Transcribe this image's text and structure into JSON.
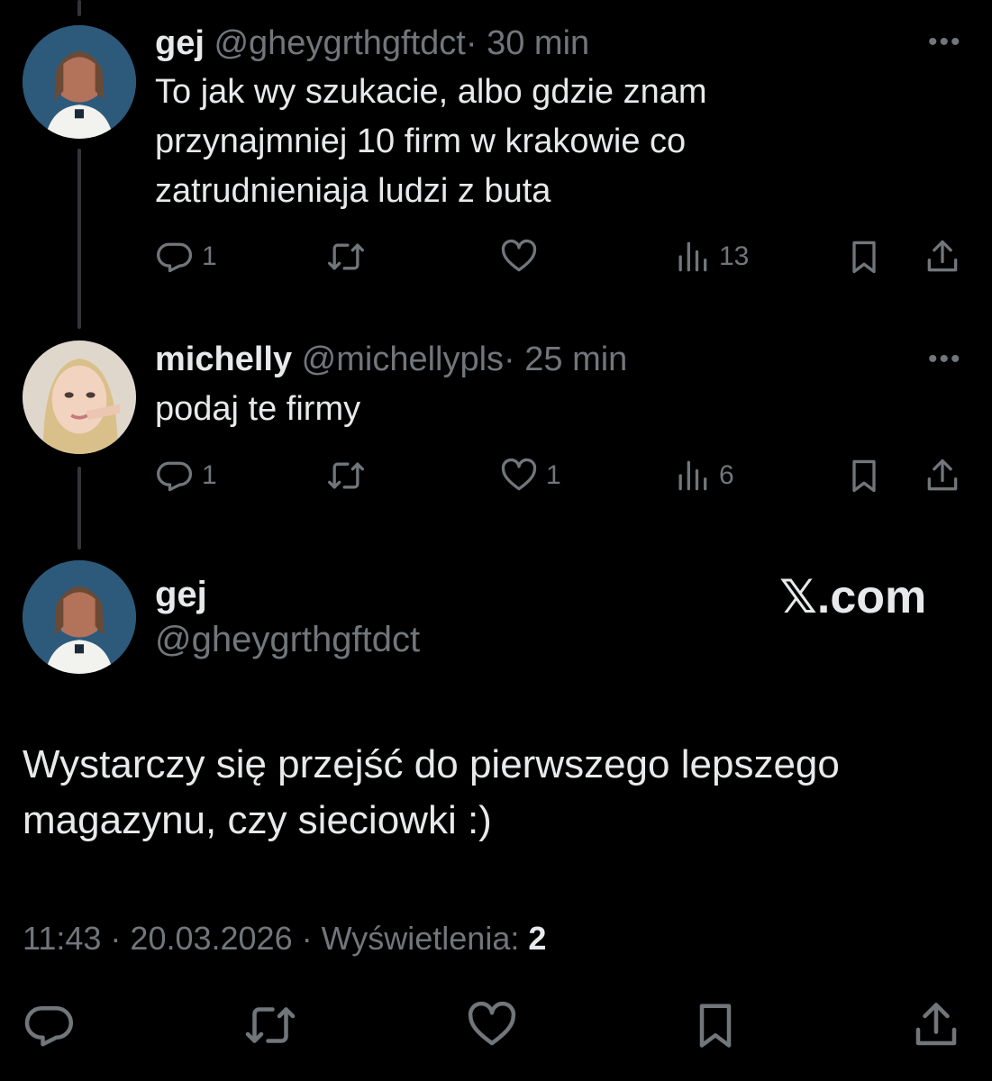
{
  "tweet1": {
    "name": "gej",
    "handle": "@gheygrthgftdct",
    "time": "· 30 min",
    "text": "To jak wy szukacie, albo gdzie znam przynajmniej 10 firm w krakowie co zatrudnieniaja ludzi z buta",
    "more": "•••",
    "replies": "1",
    "retweets": "",
    "likes": "",
    "views": "13"
  },
  "tweet2": {
    "name": "michelly",
    "handle": "@michellypls",
    "time": "· 25 min",
    "text": "podaj te firmy",
    "more": "•••",
    "replies": "1",
    "retweets": "",
    "likes": "1",
    "views": "6"
  },
  "main": {
    "name": "gej",
    "handle": "@gheygrthgftdct",
    "watermark": "𝕏.com",
    "text_line1": "Wystarczy się przejść do pierwszego lepszego",
    "text_line2": "magazynu, czy sieciowki :)",
    "time": "11:43",
    "sep1": " · ",
    "date": "20.03.2026",
    "sep2": " · ",
    "views_label": "Wyświetlenia: ",
    "views": "2"
  },
  "icons": {
    "reply": "reply-icon",
    "retweet": "retweet-icon",
    "like": "heart-icon",
    "views": "views-icon",
    "bookmark": "bookmark-icon",
    "share": "share-icon"
  },
  "colors": {
    "background": "#000000",
    "text": "#e7e9ea",
    "muted": "#71767b",
    "thread_line": "#333639"
  }
}
